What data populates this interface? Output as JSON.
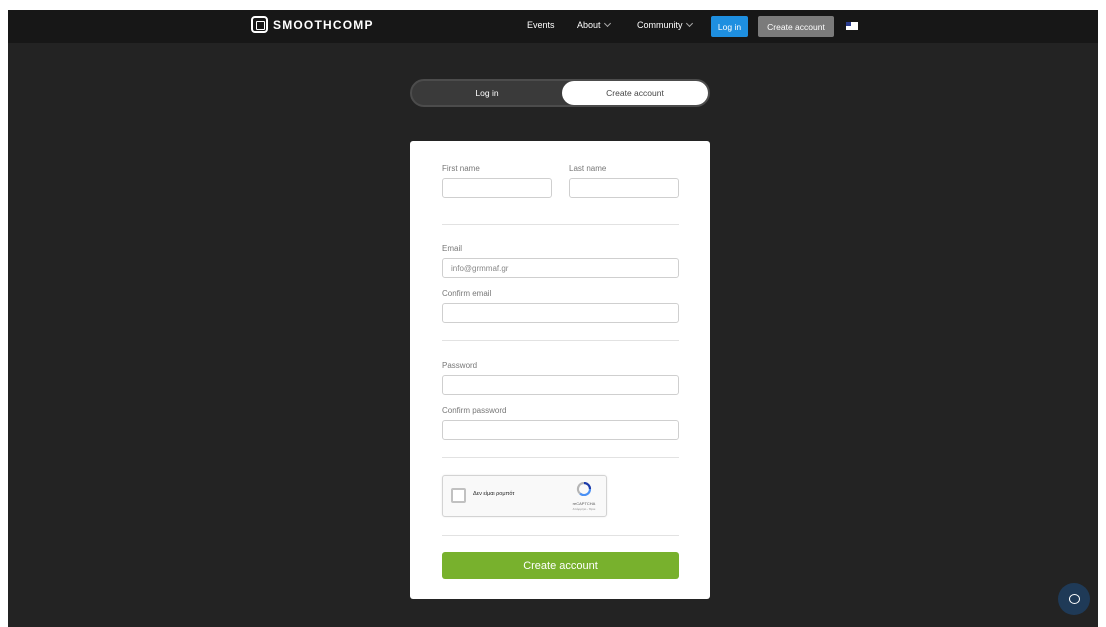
{
  "nav": {
    "logo_text": "SMOOTHCOMP",
    "events": "Events",
    "about": "About",
    "community": "Community",
    "login": "Log in",
    "create_account": "Create account",
    "language_flag": "us-flag-icon"
  },
  "switcher": {
    "login": "Log in",
    "create_account": "Create account"
  },
  "form": {
    "first_name_label": "First name",
    "first_name_value": "",
    "last_name_label": "Last name",
    "last_name_value": "",
    "email_label": "Email",
    "email_placeholder": "info@grmmaf.gr",
    "confirm_email_label": "Confirm email",
    "confirm_email_value": "",
    "password_label": "Password",
    "password_value": "",
    "confirm_password_label": "Confirm password",
    "confirm_password_value": "",
    "captcha_text": "Δεν είμαι ρομπότ",
    "captcha_brand": "reCAPTCHA",
    "captcha_terms": "Απόρρητο - Όροι",
    "submit": "Create account"
  },
  "colors": {
    "background": "#232323",
    "navbar": "#171717",
    "login_button": "#1e8fe0",
    "create_button": "#7b7b7b",
    "submit_button": "#78b12d",
    "chat_button": "#1f3a57"
  },
  "chat": {
    "icon": "chat-bubble-icon"
  }
}
